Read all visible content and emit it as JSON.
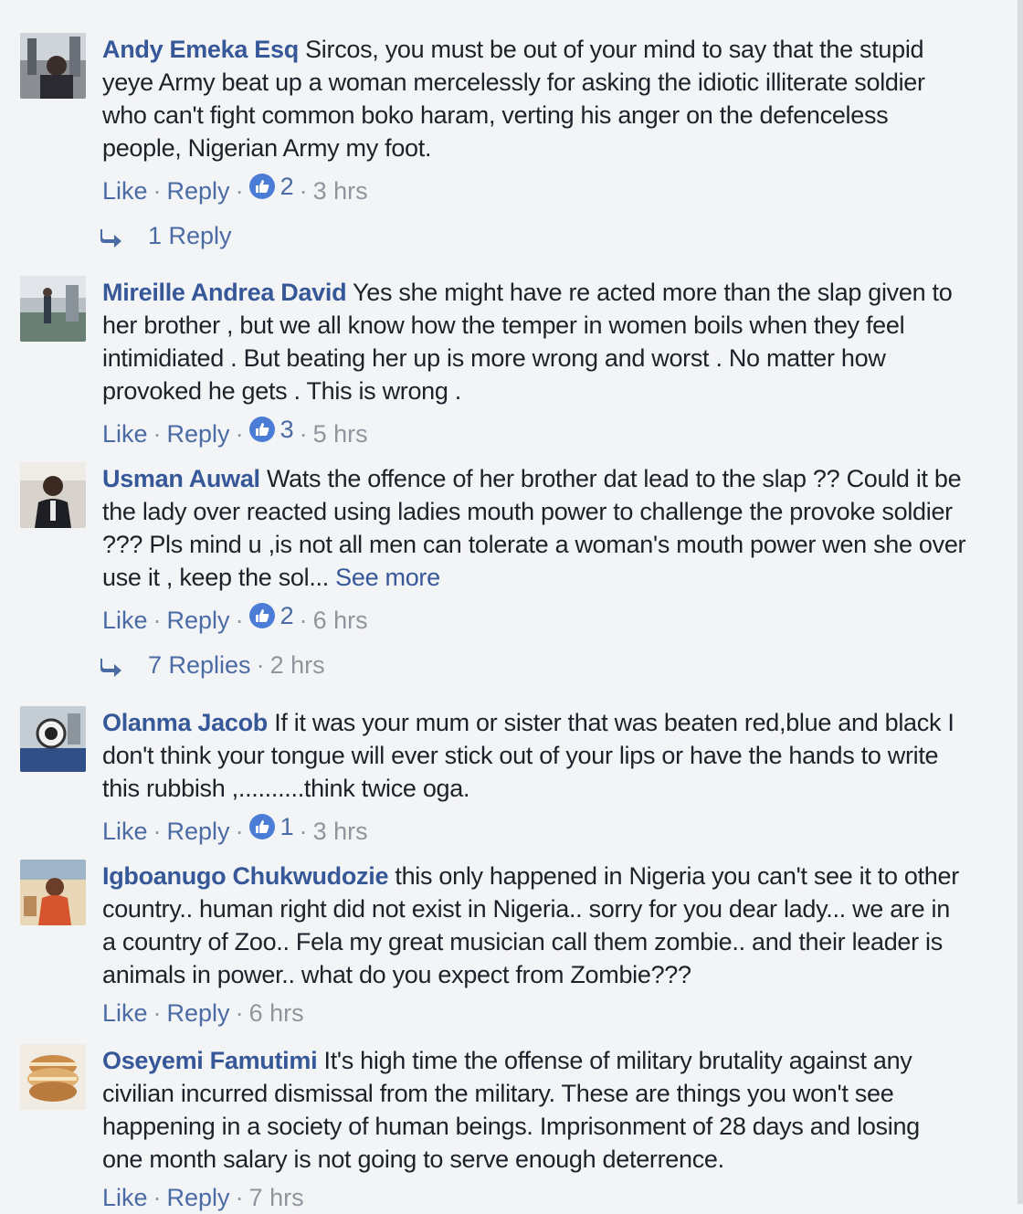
{
  "comments": [
    {
      "author": "Andy Emeka Esq",
      "text": "Sircos, you must be out of your mind to say that the stupid yeye Army beat up a woman mercelessly for asking the idiotic illiterate soldier who can't fight common boko haram, verting his anger on the defenceless people, Nigerian Army my foot.",
      "like": "Like",
      "reply": "Reply",
      "likes": "2",
      "time": "3 hrs",
      "replies_label": "1 Reply",
      "replies_time": ""
    },
    {
      "author": "Mireille Andrea David",
      "text": "Yes she might have re acted more than the slap given to her brother , but we all know how the temper in women boils when they feel intimidiated . But beating her up is more wrong and worst . No matter how provoked he gets . This is wrong .",
      "like": "Like",
      "reply": "Reply",
      "likes": "3",
      "time": "5 hrs"
    },
    {
      "author": "Usman Auwal",
      "text": "Wats the offence of her brother dat lead to the slap ?? Could it be the lady over reacted using ladies mouth power to challenge the provoke soldier ??? Pls mind u ,is not all men can tolerate a woman's mouth power wen she over use it , keep the sol...",
      "see_more": "See more",
      "like": "Like",
      "reply": "Reply",
      "likes": "2",
      "time": "6 hrs",
      "replies_label": "7 Replies",
      "replies_time": "2 hrs"
    },
    {
      "author": "Olanma Jacob",
      "text": "If it was your mum or sister that was beaten red,blue and black I don't think your tongue will ever stick out of your lips or have the hands to write this rubbish ,..........think twice oga.",
      "like": "Like",
      "reply": "Reply",
      "likes": "1",
      "time": "3 hrs"
    },
    {
      "author": "Igboanugo Chukwudozie",
      "text": "this only happened in Nigeria you can't see it to other country.. human right did not exist in Nigeria.. sorry for you dear lady... we are in a country of Zoo.. Fela my great musician call them zombie.. and their leader is animals in power.. what do you expect from Zombie???",
      "like": "Like",
      "reply": "Reply",
      "time": "6 hrs"
    },
    {
      "author": "Oseyemi Famutimi",
      "text": "It's high time the offense of military brutality against any civilian incurred dismissal from the military. These are things you won't see happening in a society of human beings. Imprisonment of 28 days and losing one month salary is not going to serve enough deterrence.",
      "like": "Like",
      "reply": "Reply",
      "time": "7 hrs"
    }
  ],
  "colors": {
    "link": "#365899",
    "action": "#4b6ba5",
    "meta": "#90949c",
    "like_badge": "#4b7cd6",
    "background": "#f3f4f6"
  },
  "icons": {
    "like_badge": "thumbs-up-icon",
    "reply_arrow": "reply-arrow-icon"
  }
}
